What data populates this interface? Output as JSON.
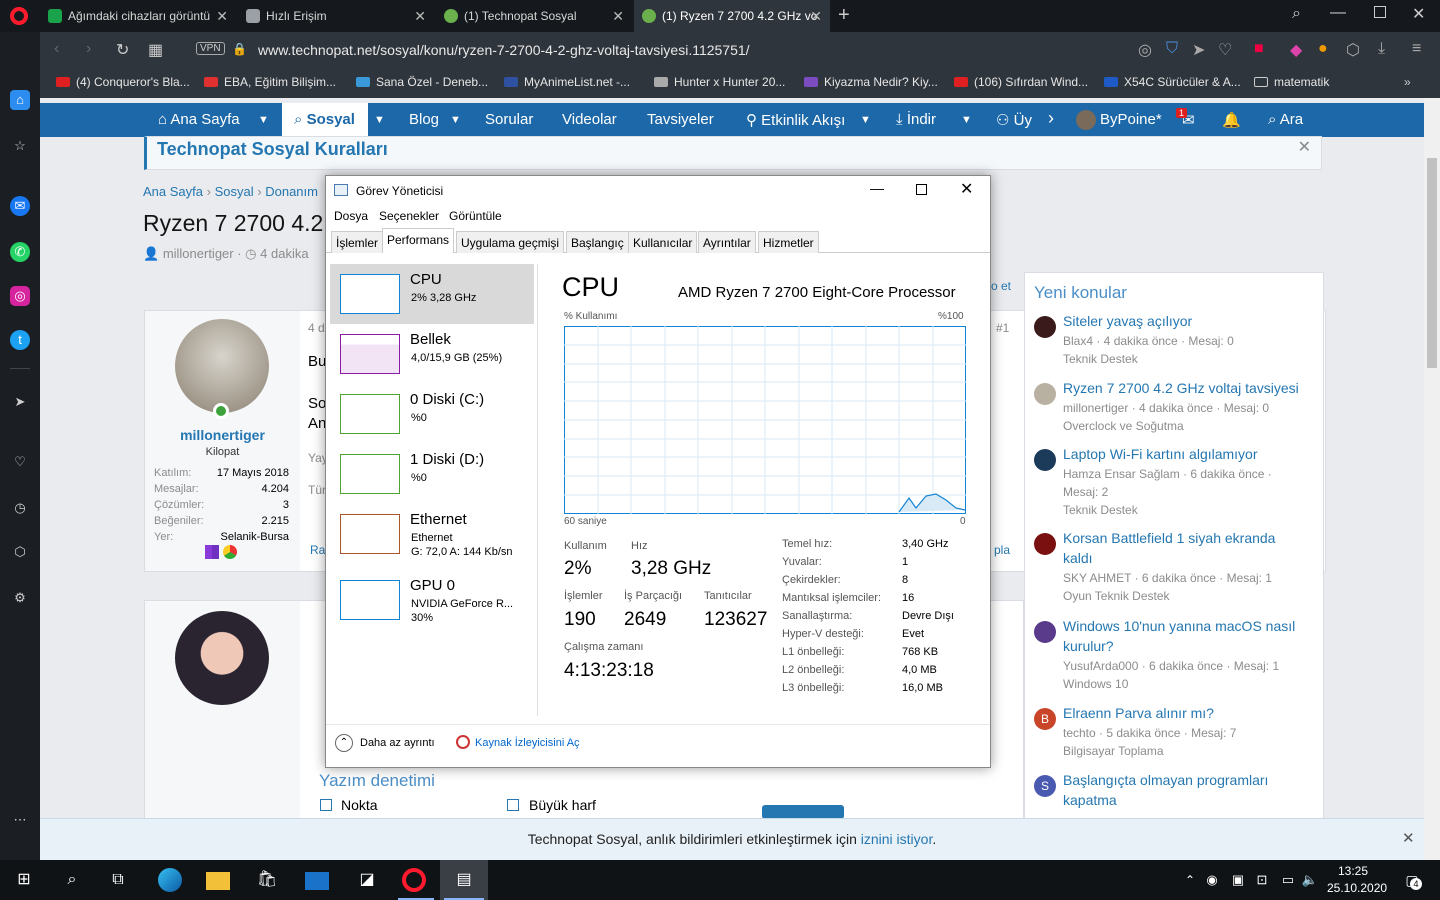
{
  "tabs": [
    {
      "label": "Ağımdaki cihazları görüntü",
      "color": "#1aa34a"
    },
    {
      "label": "Hızlı Erişim",
      "color": "#9aa0a6"
    },
    {
      "label": "(1) Technopat Sosyal",
      "color": "#6ab04c"
    },
    {
      "label": "(1) Ryzen 7 2700 4.2 GHz vo",
      "color": "#6ab04c"
    }
  ],
  "address": {
    "url": "www.technopat.net/sosyal/konu/ryzen-7-2700-4-2-ghz-voltaj-tavsiyesi.1125751/",
    "vpn": "VPN"
  },
  "bookmarks": [
    {
      "label": "(4) Conqueror's Bla...",
      "color": "#e02020"
    },
    {
      "label": "EBA, Eğitim Bilişim...",
      "color": "#e03030"
    },
    {
      "label": "Sana Özel - Deneb...",
      "color": "#3a9ad9"
    },
    {
      "label": "MyAnimeList.net -...",
      "color": "#2e51a2"
    },
    {
      "label": "Hunter x Hunter 20...",
      "color": "#aaaaaa"
    },
    {
      "label": "Kiyazma Nedir? Kiy...",
      "color": "#7a4cc0"
    },
    {
      "label": "(106) Sıfırdan Wind...",
      "color": "#e02020"
    },
    {
      "label": "X54C Sürücüler & A...",
      "color": "#1e5bc6"
    },
    {
      "label": "matematik",
      "color": "#cccccc"
    }
  ],
  "nav": {
    "home": "Ana Sayfa",
    "sosyal": "Sosyal",
    "blog": "Blog",
    "sorular": "Sorular",
    "videolar": "Videolar",
    "tavsiyeler": "Tavsiyeler",
    "etkinlik": "Etkinlik Akışı",
    "indir": "İndir",
    "uye": "Üy",
    "user": "ByPoine*",
    "ara": "Ara",
    "msg_badge": "1"
  },
  "notice": {
    "title": "Technopat Sosyal Kuralları"
  },
  "breadcrumb": {
    "home": "Ana Sayfa",
    "sosyal": "Sosyal",
    "donanim": "Donanım"
  },
  "thread": {
    "title": "Ryzen 7 2700 4.2",
    "author": "millonertiger",
    "time": "4 dakika"
  },
  "post": {
    "date": "4 d",
    "num": "#1",
    "bu": "Bu",
    "so": "So",
    "an": "An",
    "yay": "Yay",
    "tur": "Tür",
    "ra": "Ra",
    "pla": "pla",
    "oet": "o et"
  },
  "user_card": {
    "name": "millonertiger",
    "rank": "Kilopat",
    "stats": [
      {
        "k": "Katılım:",
        "v": "17 Mayıs 2018"
      },
      {
        "k": "Mesajlar:",
        "v": "4.204"
      },
      {
        "k": "Çözümler:",
        "v": "3"
      },
      {
        "k": "Beğeniler:",
        "v": "2.215"
      },
      {
        "k": "Yer:",
        "v": "Selanik-Bursa"
      }
    ]
  },
  "editor": {
    "title": "Yazım denetimi",
    "opt1": "Nokta",
    "opt2": "Büyük harf"
  },
  "new_topics": {
    "title": "Yeni konular",
    "items": [
      {
        "title": "Siteler yavaş açılıyor",
        "meta": "Blax4 · 4 dakika önce · Mesaj: 0",
        "cat": "Teknik Destek",
        "avatar": "#3a1a1a"
      },
      {
        "title": "Ryzen 7 2700 4.2 GHz voltaj tavsiyesi",
        "meta": "millonertiger · 4 dakika önce · Mesaj: 0",
        "cat": "Overclock ve Soğutma",
        "avatar": "#b8b0a0"
      },
      {
        "title": "Laptop Wi-Fi kartını algılamıyor",
        "meta": "Hamza Ensar Sağlam · 6 dakika önce ·",
        "meta2": "Mesaj: 2",
        "cat": "Teknik Destek",
        "avatar": "#1c3a5a"
      },
      {
        "title": "Korsan Battlefield 1 siyah ekranda",
        "title2": "kaldı",
        "meta": "SKY AHMET · 6 dakika önce · Mesaj: 1",
        "cat": "Oyun Teknik Destek",
        "avatar": "#7a1010"
      },
      {
        "title": "Windows 10'nun yanına macOS nasıl",
        "title2": "kurulur?",
        "meta": "YusufArda000 · 6 dakika önce · Mesaj: 1",
        "cat": "Windows 10",
        "avatar": "#5a3a8a"
      },
      {
        "title": "Elraenn Parva alınır mı?",
        "meta": "techto · 5 dakika önce · Mesaj: 7",
        "cat": "Bilgisayar Toplama",
        "avatar": "#c8452a",
        "initial": "B"
      },
      {
        "title": "Başlangıçta olmayan programları",
        "title2": "kapatma",
        "avatar": "#4a5ab0",
        "initial": "S"
      }
    ]
  },
  "notification": {
    "text": "Technopat Sosyal, anlık bildirimleri etkinleştirmek için ",
    "link": "iznini istiyor",
    "end": "."
  },
  "taskmgr": {
    "title": "Görev Yöneticisi",
    "menu": [
      "Dosya",
      "Seçenekler",
      "Görüntüle"
    ],
    "tabs": [
      "İşlemler",
      "Performans",
      "Uygulama geçmişi",
      "Başlangıç",
      "Kullanıcılar",
      "Ayrıntılar",
      "Hizmetler"
    ],
    "resources": [
      {
        "name": "CPU",
        "sub": "2% 3,28 GHz",
        "color": "#1183d4"
      },
      {
        "name": "Bellek",
        "sub": "4,0/15,9 GB (25%)",
        "color": "#8b1aa6"
      },
      {
        "name": "0 Diski (C:)",
        "sub": "%0",
        "color": "#4da32f"
      },
      {
        "name": "1 Diski (D:)",
        "sub": "%0",
        "color": "#4da32f"
      },
      {
        "name": "Ethernet",
        "sub": "Ethernet",
        "sub2": "G: 72,0  A: 144 Kb/sn",
        "color": "#a7572a"
      },
      {
        "name": "GPU 0",
        "sub": "NVIDIA GeForce R...",
        "sub2": "30%",
        "color": "#1183d4"
      }
    ],
    "cpu": {
      "heading": "CPU",
      "model": "AMD Ryzen 7 2700 Eight-Core Processor",
      "usage_label": "% Kullanımı",
      "max_label": "%100",
      "time_label": "60 saniye",
      "zero": "0",
      "kullanim_l": "Kullanım",
      "kullanim": "2%",
      "hiz_l": "Hız",
      "hiz": "3,28 GHz",
      "islemler_l": "İşlemler",
      "islemler": "190",
      "parcacik_l": "İş Parçacığı",
      "parcacik": "2649",
      "tanitici_l": "Tanıtıcılar",
      "tanitici": "123627",
      "calisma_l": "Çalışma zamanı",
      "calisma": "4:13:23:18",
      "specs": [
        {
          "k": "Temel hız:",
          "v": "3,40 GHz"
        },
        {
          "k": "Yuvalar:",
          "v": "1"
        },
        {
          "k": "Çekirdekler:",
          "v": "8"
        },
        {
          "k": "Mantıksal işlemciler:",
          "v": "16"
        },
        {
          "k": "Sanallaştırma:",
          "v": "Devre Dışı"
        },
        {
          "k": "Hyper-V desteği:",
          "v": "Evet"
        },
        {
          "k": "L1 önbelleği:",
          "v": "768 KB"
        },
        {
          "k": "L2 önbelleği:",
          "v": "4,0 MB"
        },
        {
          "k": "L3 önbelleği:",
          "v": "16,0 MB"
        }
      ]
    },
    "footer": {
      "less": "Daha az ayrıntı",
      "monitor": "Kaynak İzleyicisini Aç"
    }
  },
  "clock": {
    "time": "13:25",
    "date": "25.10.2020",
    "notif_count": "4"
  }
}
